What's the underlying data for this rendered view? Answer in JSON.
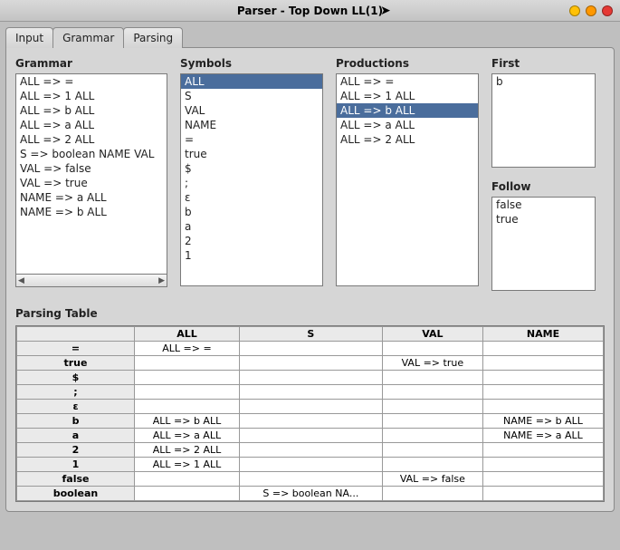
{
  "window": {
    "title": "Parser - Top Down LL(1)"
  },
  "tabs": [
    {
      "label": "Input"
    },
    {
      "label": "Grammar",
      "active": true
    },
    {
      "label": "Parsing"
    }
  ],
  "panels": {
    "grammar": {
      "title": "Grammar",
      "items": [
        "ALL => =",
        "ALL => 1 ALL",
        "ALL => b ALL",
        "ALL => a ALL",
        "ALL => 2 ALL",
        "S => boolean NAME VAL",
        "VAL => false",
        "VAL => true",
        "NAME => a ALL",
        "NAME => b ALL"
      ]
    },
    "symbols": {
      "title": "Symbols",
      "items": [
        "ALL",
        "S",
        "VAL",
        "NAME",
        "=",
        "true",
        "$",
        ";",
        "ε",
        "b",
        "a",
        "2",
        "1"
      ],
      "selected_index": 0
    },
    "productions": {
      "title": "Productions",
      "items": [
        "ALL => =",
        "ALL => 1 ALL",
        "ALL => b ALL",
        "ALL => a ALL",
        "ALL => 2 ALL"
      ],
      "selected_index": 2
    },
    "first": {
      "title": "First",
      "items": [
        "b"
      ]
    },
    "follow": {
      "title": "Follow",
      "items": [
        "false",
        "true"
      ]
    }
  },
  "parsing_table": {
    "title": "Parsing Table",
    "columns": [
      "ALL",
      "S",
      "VAL",
      "NAME"
    ],
    "rows": [
      {
        "head": "=",
        "cells": [
          "ALL => =",
          "",
          "",
          ""
        ]
      },
      {
        "head": "true",
        "cells": [
          "",
          "",
          "VAL => true",
          ""
        ]
      },
      {
        "head": "$",
        "cells": [
          "",
          "",
          "",
          ""
        ]
      },
      {
        "head": ";",
        "cells": [
          "",
          "",
          "",
          ""
        ]
      },
      {
        "head": "ε",
        "cells": [
          "",
          "",
          "",
          ""
        ]
      },
      {
        "head": "b",
        "cells": [
          "ALL => b ALL",
          "",
          "",
          "NAME => b ALL"
        ]
      },
      {
        "head": "a",
        "cells": [
          "ALL => a ALL",
          "",
          "",
          "NAME => a ALL"
        ]
      },
      {
        "head": "2",
        "cells": [
          "ALL => 2 ALL",
          "",
          "",
          ""
        ]
      },
      {
        "head": "1",
        "cells": [
          "ALL => 1 ALL",
          "",
          "",
          ""
        ]
      },
      {
        "head": "false",
        "cells": [
          "",
          "",
          "VAL => false",
          ""
        ]
      },
      {
        "head": "boolean",
        "cells": [
          "",
          "S => boolean NA...",
          "",
          ""
        ]
      }
    ]
  }
}
